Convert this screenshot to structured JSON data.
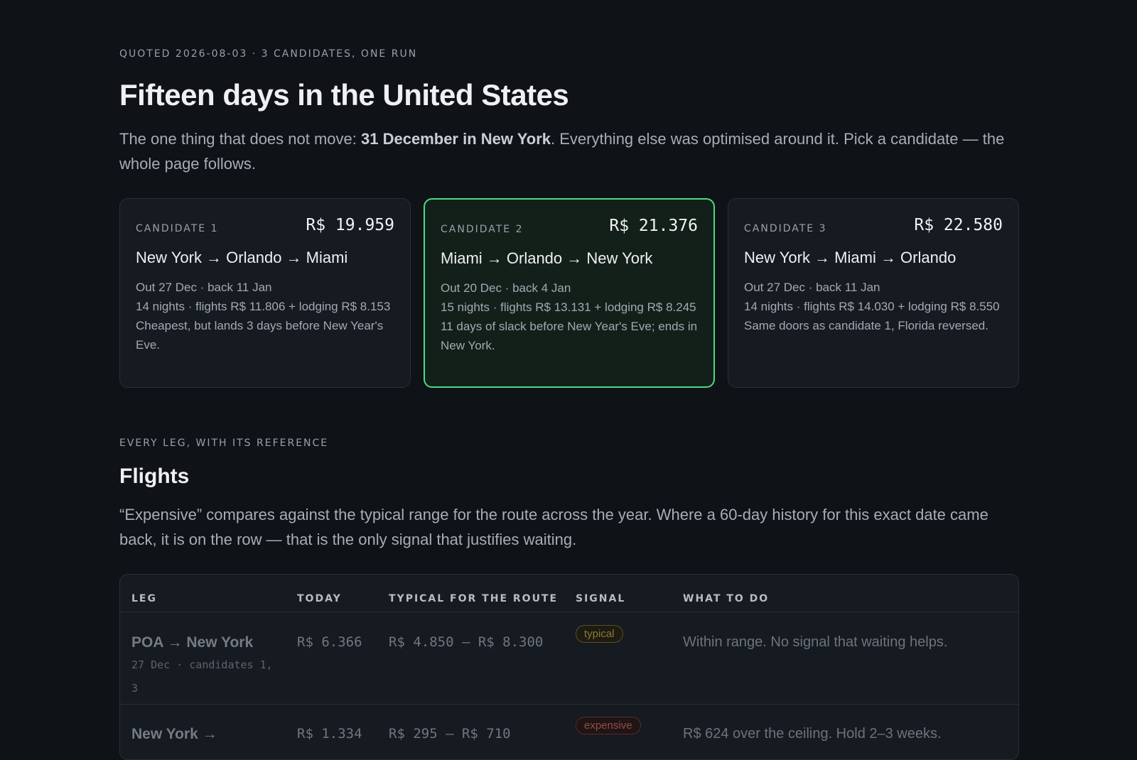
{
  "header": {
    "eyebrow": "QUOTED 2026-08-03 · 3 CANDIDATES, ONE RUN",
    "title": "Fifteen days in the United States",
    "lede_pre": "The one thing that does not move: ",
    "lede_bold": "31 December in New York",
    "lede_post": ". Everything else was optimised around it. Pick a candidate — the whole page follows."
  },
  "candidates": [
    {
      "label": "CANDIDATE 1",
      "price": "R$ 19.959",
      "route": "New York → Orlando → Miami",
      "dates": "Out 27 Dec · back 11 Jan",
      "breakdown": "14 nights · flights R$ 11.806 + lodging R$ 8.153",
      "note": "Cheapest, but lands 3 days before New Year's Eve.",
      "selected": false
    },
    {
      "label": "CANDIDATE 2",
      "price": "R$ 21.376",
      "route": "Miami → Orlando → New York",
      "dates": "Out 20 Dec · back 4 Jan",
      "breakdown": "15 nights · flights R$ 13.131 + lodging R$ 8.245",
      "note": "11 days of slack before New Year's Eve; ends in New York.",
      "selected": true
    },
    {
      "label": "CANDIDATE 3",
      "price": "R$ 22.580",
      "route": "New York → Miami → Orlando",
      "dates": "Out 27 Dec · back 11 Jan",
      "breakdown": "14 nights · flights R$ 14.030 + lodging R$ 8.550",
      "note": "Same doors as candidate 1, Florida reversed.",
      "selected": false
    }
  ],
  "flights": {
    "eyebrow": "EVERY LEG, WITH ITS REFERENCE",
    "title": "Flights",
    "desc": "“Expensive” compares against the typical range for the route across the year. Where a 60-day history for this exact date came back, it is on the row — that is the only signal that justifies waiting.",
    "columns": [
      "LEG",
      "TODAY",
      "TYPICAL FOR THE ROUTE",
      "SIGNAL",
      "WHAT TO DO"
    ],
    "rows": [
      {
        "leg": "POA → New York",
        "leg_sub": "27 Dec · candidates 1, 3",
        "today": "R$ 6.366",
        "typical": "R$ 4.850 – R$ 8.300",
        "signal": "typical",
        "todo": "Within range. No signal that waiting helps."
      },
      {
        "leg": "New York →",
        "leg_sub": "",
        "today": "R$ 1.334",
        "typical": "R$ 295 – R$ 710",
        "signal": "expensive",
        "todo": "R$ 624 over the ceiling. Hold 2–3 weeks."
      }
    ]
  },
  "colors": {
    "background": "#0f1216",
    "card": "#161a21",
    "selected_border": "#4ade80",
    "badge_typical": "#8a7a32",
    "badge_expensive": "#9a4a4a"
  }
}
